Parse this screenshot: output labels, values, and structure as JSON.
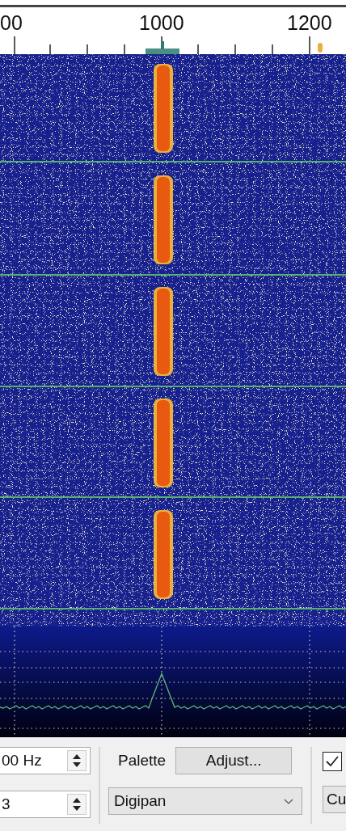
{
  "scale": {
    "labels": [
      {
        "text": "00"
      },
      {
        "text": "1000"
      },
      {
        "text": "1200"
      }
    ]
  },
  "controls": {
    "frequency_spin": {
      "value": "00 Hz"
    },
    "number_spin": {
      "value": "3"
    },
    "palette_label": "Palette",
    "adjust_button": "Adjust...",
    "palette_combo": {
      "value": "Digipan"
    },
    "checkbox": {
      "checked": true
    },
    "cut_combo": {
      "value": "Cu"
    }
  }
}
